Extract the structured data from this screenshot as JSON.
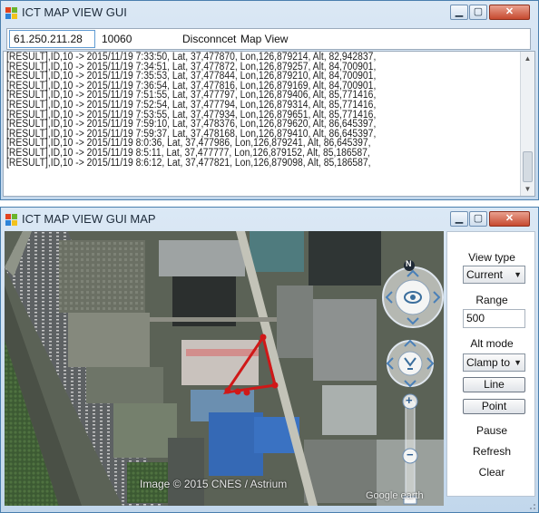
{
  "window1": {
    "title": "ICT MAP VIEW GUI",
    "controls": {
      "minimize": "▁",
      "maximize": "▢",
      "close": "✕"
    },
    "toolbar": {
      "ip_value": "61.250.211.28",
      "port": "10060",
      "disconnect_label": "Disconncet",
      "mapview_label": "Map View"
    },
    "log_lines": [
      "[RESULT],ID,10 -> 2015/11/19 7:33:50, Lat, 37,477870, Lon,126,879214, Alt, 82,942837,",
      "[RESULT],ID,10 -> 2015/11/19 7:34:51, Lat, 37,477872, Lon,126,879257, Alt, 84,700901,",
      "[RESULT],ID,10 -> 2015/11/19 7:35:53, Lat, 37,477844, Lon,126,879210, Alt, 84,700901,",
      "[RESULT],ID,10 -> 2015/11/19 7:36:54, Lat, 37,477816, Lon,126,879169, Alt, 84,700901,",
      "[RESULT],ID,10 -> 2015/11/19 7:51:55, Lat, 37,477797, Lon,126,879406, Alt, 85,771416,",
      "[RESULT],ID,10 -> 2015/11/19 7:52:54, Lat, 37,477794, Lon,126,879314, Alt, 85,771416,",
      "[RESULT],ID,10 -> 2015/11/19 7:53:55, Lat, 37,477934, Lon,126,879651, Alt, 85,771416,",
      "[RESULT],ID,10 -> 2015/11/19 7:59:10, Lat, 37,478376, Lon,126,879620, Alt, 86,645397,",
      "[RESULT],ID,10 -> 2015/11/19 7:59:37, Lat, 37,478168, Lon,126,879410, Alt, 86,645397,",
      "[RESULT],ID,10 -> 2015/11/19 8:0:36, Lat, 37,477986, Lon,126,879241, Alt, 86,645397,",
      "[RESULT],ID,10 -> 2015/11/19 8:5:11, Lat, 37,477777, Lon,126,879152, Alt, 85,186587,",
      "[RESULT],ID,10 -> 2015/11/19 8:6:12, Lat, 37,477821, Lon,126,879098, Alt, 85,186587,"
    ]
  },
  "window2": {
    "title": "ICT MAP VIEW GUI MAP",
    "controls": {
      "minimize": "▁",
      "maximize": "▢",
      "close": "✕"
    },
    "map": {
      "attribution": "Image © 2015 CNES / Astrium",
      "brand": "Google earth",
      "compass_north": "N",
      "zoom_plus": "+",
      "zoom_minus": "−"
    },
    "panel": {
      "view_type_label": "View type",
      "view_type_value": "Current",
      "range_label": "Range",
      "range_value": "500",
      "alt_mode_label": "Alt mode",
      "alt_mode_value": "Clamp to",
      "line_button": "Line",
      "point_button": "Point",
      "pause_link": "Pause",
      "refresh_link": "Refresh",
      "clear_link": "Clear"
    }
  },
  "colors": {
    "track": "#d01818",
    "title_bar": "#c9dcef",
    "input_focus": "#5f9bd3"
  }
}
